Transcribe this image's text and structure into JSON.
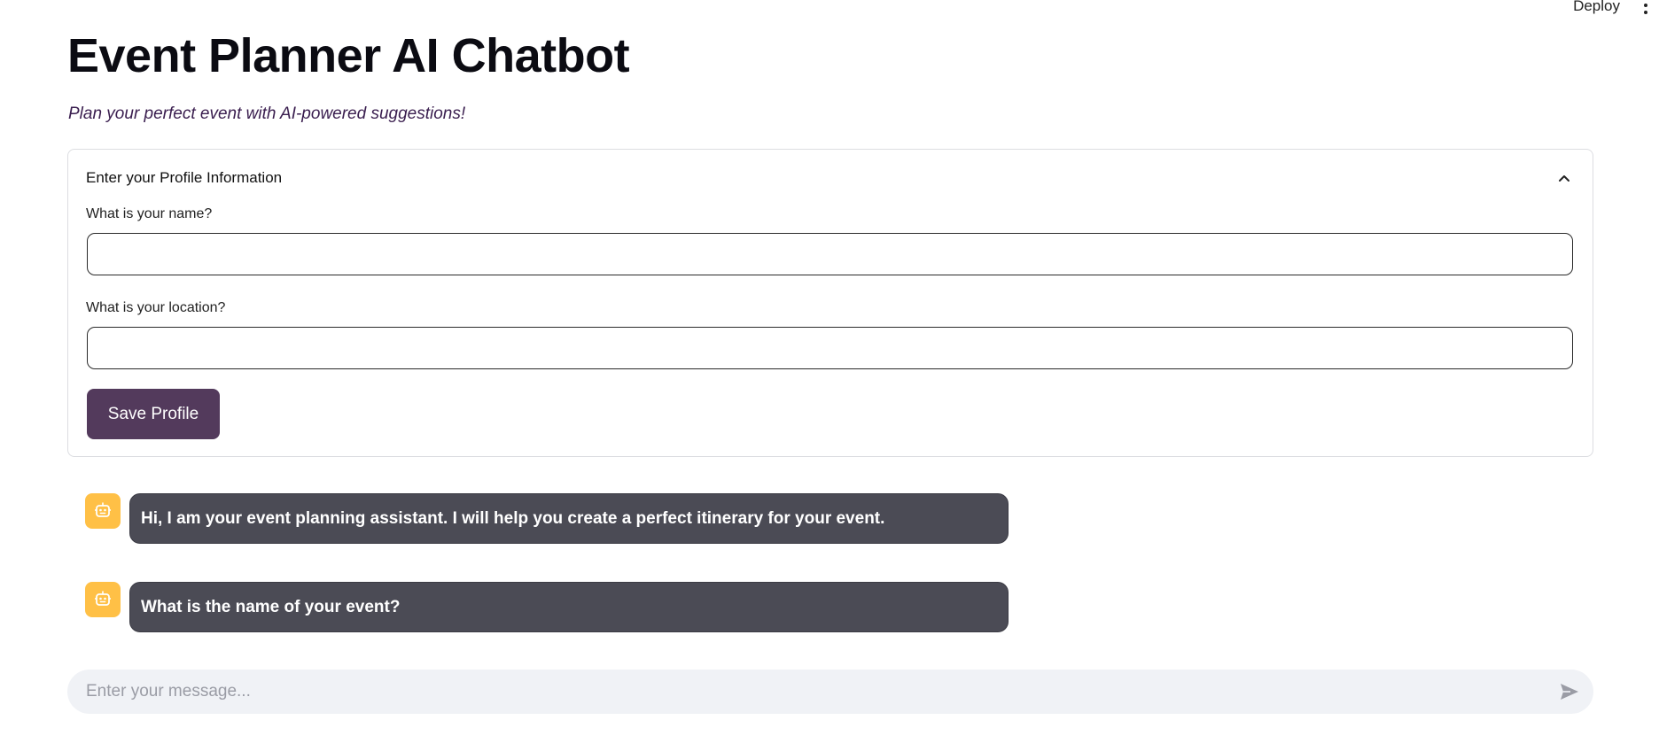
{
  "toolbar": {
    "deploy_label": "Deploy",
    "menu_icon": "vertical-ellipsis"
  },
  "header": {
    "title": "Event Planner AI Chatbot",
    "subtitle": "Plan your perfect event with AI-powered suggestions!"
  },
  "profile": {
    "expander_title": "Enter your Profile Information",
    "expanded": true,
    "name_label": "What is your name?",
    "name_value": "",
    "location_label": "What is your location?",
    "location_value": "",
    "save_label": "Save Profile"
  },
  "chat": {
    "messages": [
      {
        "role": "assistant",
        "avatar_icon": "robot-icon",
        "text": "Hi, I am your event planning assistant. I will help you create a perfect itinerary for your event."
      },
      {
        "role": "assistant",
        "avatar_icon": "robot-icon",
        "text": "What is the name of your event?"
      }
    ],
    "input_placeholder": "Enter your message...",
    "input_value": ""
  },
  "colors": {
    "primary_button": "#533a5c",
    "avatar_bg": "#ffc046",
    "bubble_bg": "#4b4b55",
    "input_bg": "#f0f2f6",
    "subtitle": "#3a1e4f"
  }
}
